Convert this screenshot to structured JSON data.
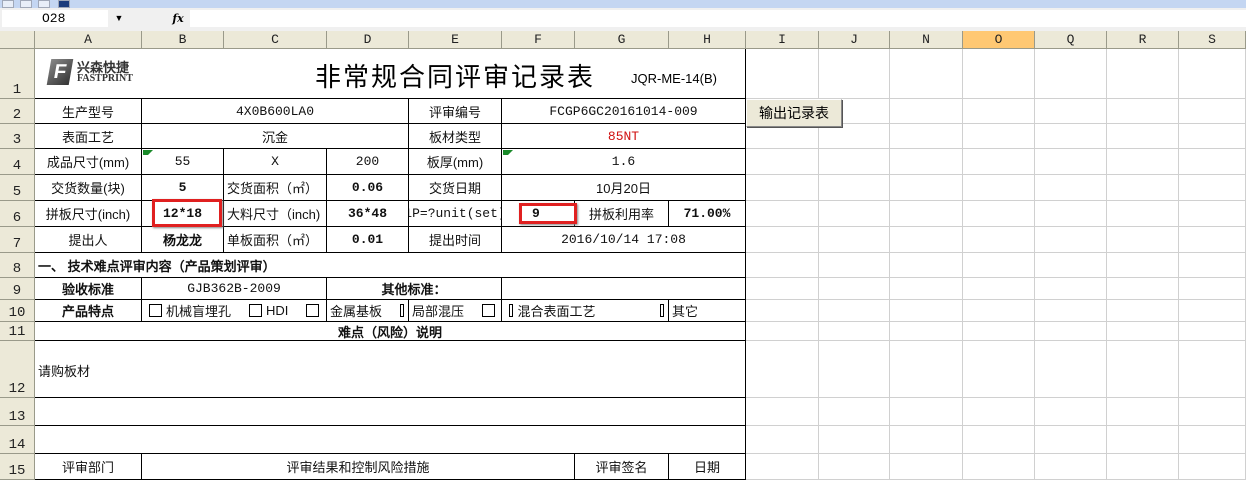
{
  "formula_bar": {
    "name_box": "O28",
    "fx_label": "fx",
    "formula": ""
  },
  "columns": [
    "A",
    "B",
    "C",
    "D",
    "E",
    "F",
    "G",
    "H",
    "I",
    "J",
    "N",
    "O",
    "Q",
    "R",
    "S"
  ],
  "selected_column": "O",
  "rows": [
    "1",
    "2",
    "3",
    "4",
    "5",
    "6",
    "7",
    "8",
    "9",
    "10",
    "11",
    "12",
    "13",
    "14",
    "15"
  ],
  "header": {
    "title": "非常规合同评审记录表",
    "doc_code": "JQR-ME-14(B)",
    "logo_cn": "兴森快捷",
    "logo_en": "FASTPRINT"
  },
  "output_button": "输出记录表",
  "colors": {
    "accent_red": "#e02020",
    "selected_header": "#ffc873",
    "red_text": "#d01010"
  },
  "cells": [
    {
      "addr": "A2",
      "text": "生产型号"
    },
    {
      "addr": "B2",
      "text": "4X0B600LA0"
    },
    {
      "addr": "E2",
      "text": "评审编号"
    },
    {
      "addr": "F2",
      "text": "FCGP6GC20161014-009"
    },
    {
      "addr": "A3",
      "text": "表面工艺"
    },
    {
      "addr": "B3",
      "text": "沉金"
    },
    {
      "addr": "E3",
      "text": "板材类型"
    },
    {
      "addr": "F3",
      "text": "85NT"
    },
    {
      "addr": "A4",
      "text": "成品尺寸(mm)"
    },
    {
      "addr": "B4",
      "text": "55"
    },
    {
      "addr": "C4",
      "text": "X"
    },
    {
      "addr": "D4",
      "text": "200"
    },
    {
      "addr": "E4",
      "text": "板厚(mm)"
    },
    {
      "addr": "F4",
      "text": "1.6"
    },
    {
      "addr": "A5",
      "text": "交货数量(块)"
    },
    {
      "addr": "B5",
      "text": "5"
    },
    {
      "addr": "C5",
      "text": "交货面积（㎡）"
    },
    {
      "addr": "D5",
      "text": "0.06"
    },
    {
      "addr": "E5",
      "text": "交货日期"
    },
    {
      "addr": "F5",
      "text": "10月20日"
    },
    {
      "addr": "A6",
      "text": "拼板尺寸(inch)"
    },
    {
      "addr": "B6",
      "text": "12*18"
    },
    {
      "addr": "C6",
      "text": "大料尺寸（inch)"
    },
    {
      "addr": "D6",
      "text": "36*48"
    },
    {
      "addr": "E6",
      "text": "1P=?unit(set)"
    },
    {
      "addr": "F6",
      "text": "9"
    },
    {
      "addr": "G6",
      "text": "拼板利用率"
    },
    {
      "addr": "H6",
      "text": "71.00%"
    },
    {
      "addr": "A7",
      "text": "提出人"
    },
    {
      "addr": "B7",
      "text": "杨龙龙"
    },
    {
      "addr": "C7",
      "text": "单板面积（㎡）"
    },
    {
      "addr": "D7",
      "text": "0.01"
    },
    {
      "addr": "E7",
      "text": "提出时间"
    },
    {
      "addr": "F7",
      "text": "2016/10/14 17:08"
    },
    {
      "addr": "A8",
      "text": "一、 技术难点评审内容（产品策划评审）"
    },
    {
      "addr": "A9",
      "text": "验收标准"
    },
    {
      "addr": "B9",
      "text": "GJB362B-2009"
    },
    {
      "addr": "D9",
      "text": "其他标准："
    },
    {
      "addr": "F9",
      "text": ""
    },
    {
      "addr": "A10",
      "text": "产品特点"
    },
    {
      "addr": "A11",
      "text": "难点（风险）说明"
    },
    {
      "addr": "A12",
      "text": "请购板材"
    },
    {
      "addr": "A13",
      "text": ""
    },
    {
      "addr": "A14",
      "text": ""
    },
    {
      "addr": "A15",
      "text": "评审部门"
    },
    {
      "addr": "B15",
      "text": "评审结果和控制风险措施"
    },
    {
      "addr": "G15",
      "text": "评审签名"
    },
    {
      "addr": "H15",
      "text": "日期"
    }
  ],
  "product_features": [
    {
      "label": "机械盲埋孔",
      "checked": false
    },
    {
      "label": "HDI",
      "checked": false
    },
    {
      "label": "金属基板",
      "checked": false
    },
    {
      "label": "局部混压",
      "checked": false
    },
    {
      "label": "混合表面工艺",
      "checked": false
    },
    {
      "label": "其它",
      "checked": false
    }
  ],
  "highlighted_cells": [
    "B6",
    "F6"
  ]
}
